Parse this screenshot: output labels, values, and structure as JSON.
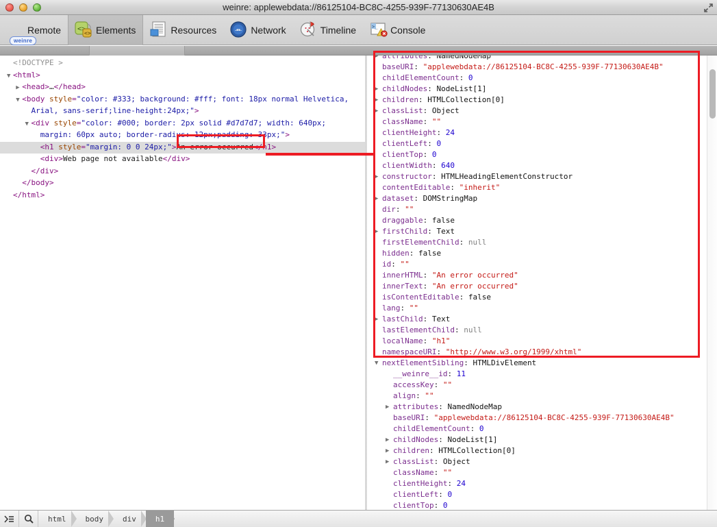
{
  "window": {
    "title": "weinre: applewebdata://86125104-BC8C-4255-939F-77130630AE4B",
    "traffic_lights": [
      "close-light",
      "minimize-light",
      "zoom-light"
    ],
    "resize_icon": "fullscreen-arrows-icon"
  },
  "toolbar": {
    "tabs": [
      {
        "label": "Remote",
        "icon": "remote-icon",
        "badge": "weinre",
        "selected": false
      },
      {
        "label": "Elements",
        "icon": "elements-icon",
        "badge": "",
        "selected": true
      },
      {
        "label": "Resources",
        "icon": "resources-icon",
        "badge": "",
        "selected": false
      },
      {
        "label": "Network",
        "icon": "network-icon",
        "badge": "",
        "selected": false
      },
      {
        "label": "Timeline",
        "icon": "timeline-icon",
        "badge": "",
        "selected": false
      },
      {
        "label": "Console",
        "icon": "console-icon",
        "badge": "",
        "selected": false
      }
    ]
  },
  "dom_tree": {
    "lines": [
      {
        "indent": 0,
        "twisty": "none",
        "html": "<span class=\"doctype\">&lt;!DOCTYPE &gt;</span>",
        "selected": false
      },
      {
        "indent": 0,
        "twisty": "open",
        "html": "<span class=\"tag\">&lt;html&gt;</span>",
        "selected": false
      },
      {
        "indent": 1,
        "twisty": "closed",
        "html": "<span class=\"tag\">&lt;head&gt;</span><span class=\"txt\">…</span><span class=\"tag\">&lt;/head&gt;</span>",
        "selected": false
      },
      {
        "indent": 1,
        "twisty": "open",
        "html": "<span class=\"tag\">&lt;body</span> <span class=\"attrname\">style</span><span class=\"tag\">=</span><span class=\"attrval\">\"color: #333; background: #fff; font: 18px normal Helvetica,</span>",
        "selected": false
      },
      {
        "indent": 2,
        "twisty": "none",
        "html": "<span class=\"attrval\">Arial, sans-serif;line-height:24px;\"</span><span class=\"tag\">&gt;</span>",
        "selected": false
      },
      {
        "indent": 2,
        "twisty": "open",
        "html": "<span class=\"tag\">&lt;div</span> <span class=\"attrname\">style</span><span class=\"tag\">=</span><span class=\"attrval\">\"color: #000; border: 2px solid #d7d7d7; width: 640px;</span>",
        "selected": false
      },
      {
        "indent": 3,
        "twisty": "none",
        "html": "<span class=\"attrval\">margin: 60px auto; border-radius: 12px;padding: 33px;\"</span><span class=\"tag\">&gt;</span>",
        "selected": false
      },
      {
        "indent": 3,
        "twisty": "none",
        "html": "<span class=\"tag\">&lt;h1</span> <span class=\"attrname\">style</span><span class=\"tag\">=</span><span class=\"attrval\">\"margin: 0 0 24px;\"</span><span class=\"tag\">&gt;</span><span class=\"txt\">An error occurred</span><span class=\"tag\">&lt;/h1&gt;</span>",
        "selected": true
      },
      {
        "indent": 3,
        "twisty": "none",
        "html": "<span class=\"tag\">&lt;div&gt;</span><span class=\"txt\">Web page not available</span><span class=\"tag\">&lt;/div&gt;</span>",
        "selected": false
      },
      {
        "indent": 2,
        "twisty": "none",
        "html": "<span class=\"tag\">&lt;/div&gt;</span>",
        "selected": false
      },
      {
        "indent": 1,
        "twisty": "none",
        "html": "<span class=\"tag\">&lt;/body&gt;</span>",
        "selected": false
      },
      {
        "indent": 0,
        "twisty": "none",
        "html": "<span class=\"tag\">&lt;/html&gt;</span>",
        "selected": false
      }
    ]
  },
  "properties": {
    "lines": [
      {
        "disc": "closed",
        "level": 1,
        "key": "attributes",
        "sep": ": ",
        "value": "NamedNodeMap",
        "vtype": "obj"
      },
      {
        "disc": "none",
        "level": 1,
        "key": "baseURI",
        "sep": ": ",
        "value": "\"applewebdata://86125104-BC8C-4255-939F-77130630AE4B\"",
        "vtype": "str"
      },
      {
        "disc": "none",
        "level": 1,
        "key": "childElementCount",
        "sep": ": ",
        "value": "0",
        "vtype": "num"
      },
      {
        "disc": "closed",
        "level": 1,
        "key": "childNodes",
        "sep": ": ",
        "value": "NodeList[1]",
        "vtype": "obj"
      },
      {
        "disc": "closed",
        "level": 1,
        "key": "children",
        "sep": ": ",
        "value": "HTMLCollection[0]",
        "vtype": "obj"
      },
      {
        "disc": "closed",
        "level": 1,
        "key": "classList",
        "sep": ": ",
        "value": "Object",
        "vtype": "obj"
      },
      {
        "disc": "none",
        "level": 1,
        "key": "className",
        "sep": ": ",
        "value": "\"\"",
        "vtype": "str"
      },
      {
        "disc": "none",
        "level": 1,
        "key": "clientHeight",
        "sep": ": ",
        "value": "24",
        "vtype": "num"
      },
      {
        "disc": "none",
        "level": 1,
        "key": "clientLeft",
        "sep": ": ",
        "value": "0",
        "vtype": "num"
      },
      {
        "disc": "none",
        "level": 1,
        "key": "clientTop",
        "sep": ": ",
        "value": "0",
        "vtype": "num"
      },
      {
        "disc": "none",
        "level": 1,
        "key": "clientWidth",
        "sep": ": ",
        "value": "640",
        "vtype": "num"
      },
      {
        "disc": "closed",
        "level": 1,
        "key": "constructor",
        "sep": ": ",
        "value": "HTMLHeadingElementConstructor",
        "vtype": "obj"
      },
      {
        "disc": "none",
        "level": 1,
        "key": "contentEditable",
        "sep": ": ",
        "value": "\"inherit\"",
        "vtype": "str"
      },
      {
        "disc": "closed",
        "level": 1,
        "key": "dataset",
        "sep": ": ",
        "value": "DOMStringMap",
        "vtype": "obj"
      },
      {
        "disc": "none",
        "level": 1,
        "key": "dir",
        "sep": ": ",
        "value": "\"\"",
        "vtype": "str"
      },
      {
        "disc": "none",
        "level": 1,
        "key": "draggable",
        "sep": ": ",
        "value": "false",
        "vtype": "bool"
      },
      {
        "disc": "closed",
        "level": 1,
        "key": "firstChild",
        "sep": ": ",
        "value": "Text",
        "vtype": "obj"
      },
      {
        "disc": "none",
        "level": 1,
        "key": "firstElementChild",
        "sep": ": ",
        "value": "null",
        "vtype": "null"
      },
      {
        "disc": "none",
        "level": 1,
        "key": "hidden",
        "sep": ": ",
        "value": "false",
        "vtype": "bool"
      },
      {
        "disc": "none",
        "level": 1,
        "key": "id",
        "sep": ": ",
        "value": "\"\"",
        "vtype": "str"
      },
      {
        "disc": "none",
        "level": 1,
        "key": "innerHTML",
        "sep": ": ",
        "value": "\"An error occurred\"",
        "vtype": "str"
      },
      {
        "disc": "none",
        "level": 1,
        "key": "innerText",
        "sep": ": ",
        "value": "\"An error occurred\"",
        "vtype": "str"
      },
      {
        "disc": "none",
        "level": 1,
        "key": "isContentEditable",
        "sep": ": ",
        "value": "false",
        "vtype": "bool"
      },
      {
        "disc": "none",
        "level": 1,
        "key": "lang",
        "sep": ": ",
        "value": "\"\"",
        "vtype": "str"
      },
      {
        "disc": "closed",
        "level": 1,
        "key": "lastChild",
        "sep": ": ",
        "value": "Text",
        "vtype": "obj"
      },
      {
        "disc": "none",
        "level": 1,
        "key": "lastElementChild",
        "sep": ": ",
        "value": "null",
        "vtype": "null"
      },
      {
        "disc": "none",
        "level": 1,
        "key": "localName",
        "sep": ": ",
        "value": "\"h1\"",
        "vtype": "str"
      },
      {
        "disc": "none",
        "level": 1,
        "key": "namespaceURI",
        "sep": ": ",
        "value": "\"http://www.w3.org/1999/xhtml\"",
        "vtype": "str"
      },
      {
        "disc": "open",
        "level": 1,
        "key": "nextElementSibling",
        "sep": ": ",
        "value": "HTMLDivElement",
        "vtype": "obj"
      },
      {
        "disc": "none",
        "level": 2,
        "key": "__weinre__id",
        "sep": ": ",
        "value": "11",
        "vtype": "num"
      },
      {
        "disc": "none",
        "level": 2,
        "key": "accessKey",
        "sep": ": ",
        "value": "\"\"",
        "vtype": "str"
      },
      {
        "disc": "none",
        "level": 2,
        "key": "align",
        "sep": ": ",
        "value": "\"\"",
        "vtype": "str"
      },
      {
        "disc": "closed",
        "level": 2,
        "key": "attributes",
        "sep": ": ",
        "value": "NamedNodeMap",
        "vtype": "obj"
      },
      {
        "disc": "none",
        "level": 2,
        "key": "baseURI",
        "sep": ": ",
        "value": "\"applewebdata://86125104-BC8C-4255-939F-77130630AE4B\"",
        "vtype": "str"
      },
      {
        "disc": "none",
        "level": 2,
        "key": "childElementCount",
        "sep": ": ",
        "value": "0",
        "vtype": "num"
      },
      {
        "disc": "closed",
        "level": 2,
        "key": "childNodes",
        "sep": ": ",
        "value": "NodeList[1]",
        "vtype": "obj"
      },
      {
        "disc": "closed",
        "level": 2,
        "key": "children",
        "sep": ": ",
        "value": "HTMLCollection[0]",
        "vtype": "obj"
      },
      {
        "disc": "closed",
        "level": 2,
        "key": "classList",
        "sep": ": ",
        "value": "Object",
        "vtype": "obj"
      },
      {
        "disc": "none",
        "level": 2,
        "key": "className",
        "sep": ": ",
        "value": "\"\"",
        "vtype": "str"
      },
      {
        "disc": "none",
        "level": 2,
        "key": "clientHeight",
        "sep": ": ",
        "value": "24",
        "vtype": "num"
      },
      {
        "disc": "none",
        "level": 2,
        "key": "clientLeft",
        "sep": ": ",
        "value": "0",
        "vtype": "num"
      },
      {
        "disc": "none",
        "level": 2,
        "key": "clientTop",
        "sep": ": ",
        "value": "0",
        "vtype": "num"
      }
    ]
  },
  "annotations": {
    "accent_color": "#ed1c24",
    "highlight_text": "An error occurred"
  },
  "statusbar": {
    "dock_icon": "dock-toggle-icon",
    "search_icon": "search-icon",
    "breadcrumb": [
      {
        "label": "html",
        "active": false
      },
      {
        "label": "body",
        "active": false
      },
      {
        "label": "div",
        "active": false
      },
      {
        "label": "h1",
        "active": true
      }
    ]
  }
}
